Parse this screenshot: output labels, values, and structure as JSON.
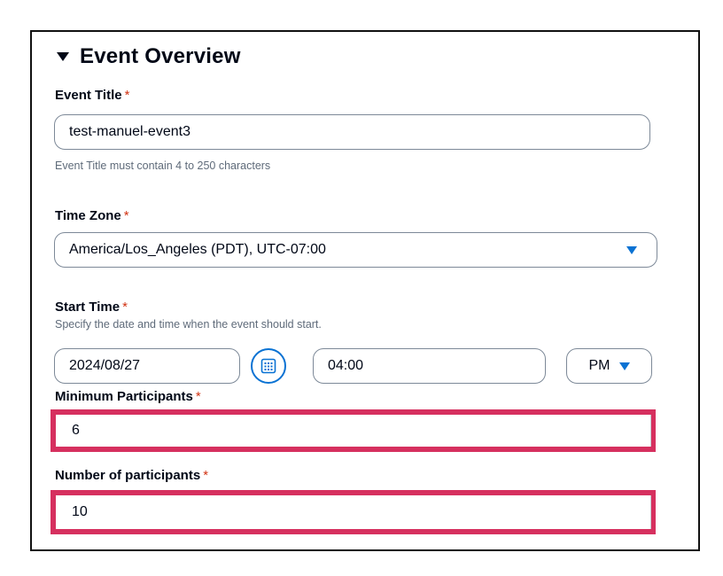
{
  "section": {
    "title": "Event Overview"
  },
  "required_marker": "*",
  "event_title": {
    "label": "Event Title",
    "value": "test-manuel-event3",
    "hint": "Event Title must contain 4 to 250 characters"
  },
  "time_zone": {
    "label": "Time Zone",
    "selected": "America/Los_Angeles (PDT), UTC-07:00"
  },
  "start_time": {
    "label": "Start Time",
    "description": "Specify the date and time when the event should start.",
    "date": "2024/08/27",
    "time": "04:00",
    "meridiem": "PM"
  },
  "minimum_participants": {
    "label": "Minimum Participants",
    "value": "6"
  },
  "number_of_participants": {
    "label": "Number of participants",
    "value": "10"
  },
  "colors": {
    "accent": "#0972d3",
    "required": "#d13212",
    "highlight": "#d6305f",
    "border": "#7d8998"
  },
  "icons": {
    "collapse": "caret-down-icon",
    "calendar": "calendar-icon",
    "dropdown": "dropdown-caret-icon"
  }
}
